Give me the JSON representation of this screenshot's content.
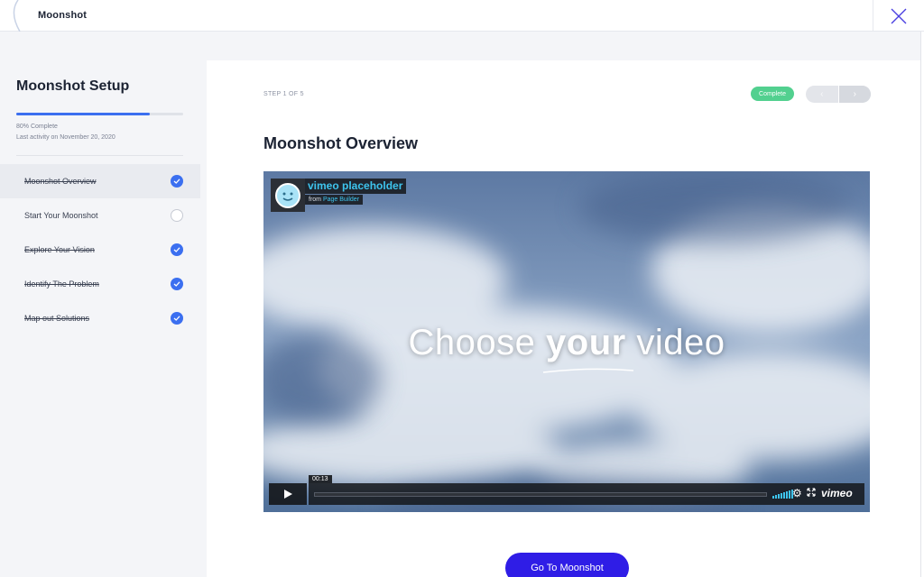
{
  "app": {
    "brand": "Moonshot"
  },
  "sidebar": {
    "title": "Moonshot Setup",
    "progress": {
      "percent": 80,
      "label": "80% Complete"
    },
    "last_activity": "Last activity on November 20, 2020",
    "steps": [
      {
        "label": "Moonshot Overview",
        "done": true,
        "active": true
      },
      {
        "label": "Start Your Moonshot",
        "done": false,
        "active": false
      },
      {
        "label": "Explore Your Vision",
        "done": true,
        "active": false
      },
      {
        "label": "Identify The Problem",
        "done": true,
        "active": false
      },
      {
        "label": "Map out Solutions",
        "done": true,
        "active": false
      }
    ]
  },
  "main": {
    "step_counter": "STEP 1 OF 5",
    "status_badge": "Complete",
    "nav": {
      "prev": "‹",
      "next": "›"
    },
    "title": "Moonshot Overview",
    "video": {
      "channel_title": "vimeo placeholder",
      "from_prefix": "from",
      "from_author": "Page Builder",
      "headline_pre": "Choose",
      "headline_bold": "your",
      "headline_post": "video",
      "timestamp": "00:13",
      "brand": "vimeo"
    },
    "cta_label": "Go To Moonshot"
  },
  "colors": {
    "accent": "#3b6ff0",
    "cta": "#2f1de6",
    "complete": "#52d08f",
    "vimeo_blue": "#3ec4ee"
  },
  "icons": {
    "close": "close-icon",
    "check": "check-icon",
    "play": "play-icon",
    "settings": "gear-icon",
    "fullscreen": "fullscreen-icon"
  }
}
